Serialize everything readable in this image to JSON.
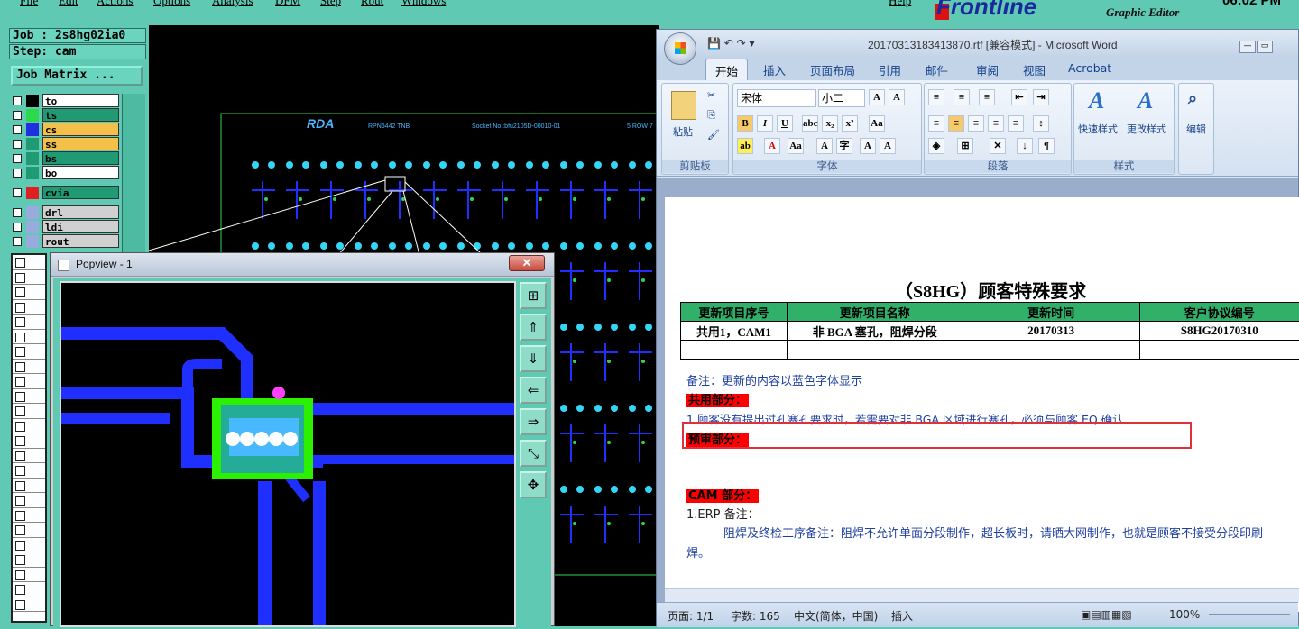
{
  "graphic_editor": {
    "menu": [
      "File",
      "Edit",
      "Actions",
      "Options",
      "Analysis",
      "DFM",
      "Step",
      "Rout",
      "Windows",
      "Help"
    ],
    "brand": "Frontline",
    "subtitle": "Graphic Editor",
    "clock": "06:02 PM",
    "job_label": "Job : 2s8hg02ia0",
    "step_label": "Step: cam",
    "job_matrix_label": "Job Matrix ...",
    "layers": [
      {
        "name": "to",
        "color": "#ffffff",
        "swatch": "#000000"
      },
      {
        "name": "ts",
        "color": "#1f9a73",
        "swatch": "#2bd94a"
      },
      {
        "name": "cs",
        "color": "#f5c04a",
        "swatch": "#2030e0"
      },
      {
        "name": "ss",
        "color": "#f5c04a",
        "swatch": "#1f9a73"
      },
      {
        "name": "bs",
        "color": "#1f9a73",
        "swatch": "#1f9a73"
      },
      {
        "name": "bo",
        "color": "#ffffff",
        "swatch": "#1f9a73"
      },
      {
        "name": "cvia",
        "color": "#1f9a73",
        "swatch": "#e02020"
      },
      {
        "name": "drl",
        "color": "#d0d0d0",
        "swatch": "#9ad"
      },
      {
        "name": "ldi",
        "color": "#d0d0d0",
        "swatch": "#9ad"
      },
      {
        "name": "rout",
        "color": "#d0d0d0",
        "swatch": "#9ad"
      }
    ],
    "board_text": [
      "RDA",
      "RPN6442 TNB",
      "Socket No.:bfu2105D-00010-01",
      "5 ROW 7"
    ]
  },
  "popview": {
    "title": "Popview - 1",
    "close": "✕"
  },
  "word": {
    "title": "20170313183413870.rtf [兼容模式] - Microsoft Word",
    "tabs": [
      "开始",
      "插入",
      "页面布局",
      "引用",
      "邮件",
      "审阅",
      "视图",
      "Acrobat"
    ],
    "font_name": "宋体",
    "font_size": "小二",
    "groups": {
      "clipboard": "剪贴板",
      "paste": "粘贴",
      "font": "字体",
      "paragraph": "段落",
      "styles": "样式",
      "quick_style": "快速样式",
      "change_style": "更改样式",
      "edit": "编辑"
    },
    "doc_title": "（S8HG）顾客特殊要求",
    "table": {
      "headers": [
        "更新项目序号",
        "更新项目名称",
        "更新时间",
        "客户协议编号"
      ],
      "rows": [
        [
          "共用1，CAM1",
          "非 BGA 塞孔，阻焊分段",
          "20170313",
          "S8HG20170310"
        ]
      ]
    },
    "note": "备注：更新的内容以蓝色字体显示",
    "section_common": "共用部分：",
    "item1": "1.顾客没有提出过孔塞孔要求时，若需要对非 BGA 区域进行塞孔，必须与顾客 EQ 确认",
    "section_pre": "预审部分：",
    "section_cam": "CAM 部分：",
    "erp_label": "1.ERP 备注：",
    "erp_text": "阻焊及终检工序备注：阻焊不允许单面分段制作，超长板时，请晒大网制作，也就是顾客不接受分段印刷",
    "erp_text2": "焊。",
    "status": {
      "page": "页面: 1/1",
      "words": "字数: 165",
      "lang": "中文(简体，中国)",
      "mode": "插入",
      "zoom": "100%"
    }
  }
}
